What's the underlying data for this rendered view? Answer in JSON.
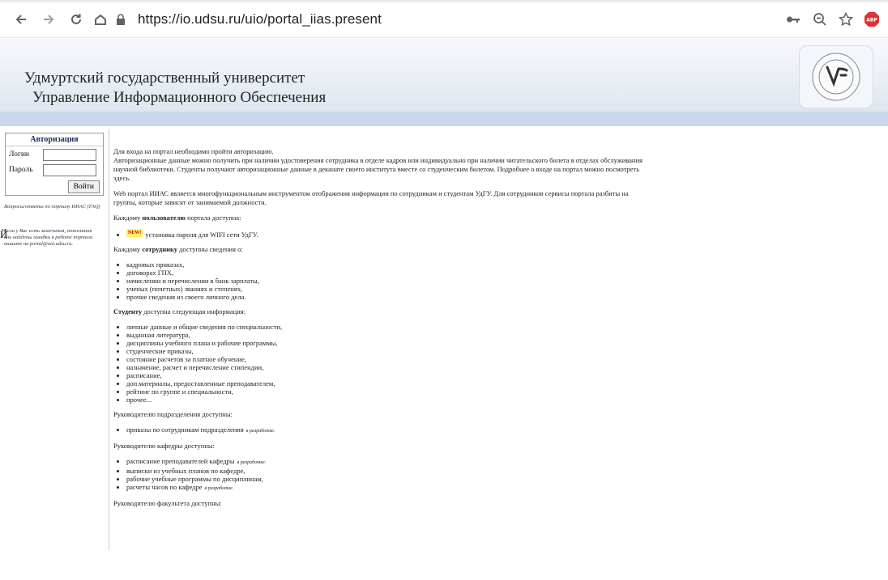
{
  "browser": {
    "url": "https://io.udsu.ru/uio/portal_iias.present"
  },
  "header": {
    "line1": "Удмуртский государственный университет",
    "line2": "Управление Информационного Обеспечения"
  },
  "sidebar": {
    "auth_title": "Авторизация",
    "login_label": "Логин",
    "password_label": "Пароль",
    "login_button": "Войти",
    "faq_note": "Вопросы/ответы по порталу ИИАС (FAQ)",
    "feedback_note": "Если у Вас есть замечания, пожелания или найдены ошибки в работе портала пишите на portal@uni.udsu.ru.",
    "stray_char": "Й"
  },
  "content": {
    "intro_p1": "Для входа на портал необходимо пройти авторизацию.",
    "intro_p2": "Авторизационные данные можно получить при наличии удостоверения сотрудника в отделе кадров или индивидуально при наличии читательского билета в отделах обслуживания научной библиотеки. Студенты получают авторизационные данные в деканате своего института вместе со студенческим билетом. Подробнее о входе на портал можно посмотреть здесь.",
    "web_p": "Web портал ИИАС является многофункциональным инструментом отображения информации по сотрудникам и студентам УдГУ. Для сотрудников сервисы портала разбиты на группы, которые зависят от занимаемой должности.",
    "users_heading_pre": "Каждому ",
    "users_heading_bold": "пользователю",
    "users_heading_post": " портала доступна:",
    "new_badge": "NEW!",
    "users_items": [
      "установка пароля для WIFI сети УдГУ."
    ],
    "staff_heading_pre": "Каждому ",
    "staff_heading_bold": "сотруднику",
    "staff_heading_post": " доступны сведения о:",
    "staff_items": [
      "кадровых приказах,",
      "договорах ГПХ,",
      "начислении и перечислении в банк зарплаты,",
      "ученых (почетных) званиях и степенях,",
      "прочие сведения из своего личного дела."
    ],
    "student_heading_bold": "Студенту",
    "student_heading_post": " доступна следующая информация:",
    "student_items": [
      "личные данные и общие сведения по специальности,",
      "выданная литература,",
      "дисциплины учебного плана и рабочие программы,",
      "студенческие приказы,",
      "состояние расчетов за платное обучение,",
      "назначение, расчет и перечисление стипендии,",
      "расписание,",
      "доп.материалы, предоставленные преподавателем,",
      "рейтинг по группе и специальности,",
      "прочее..."
    ],
    "dept_head_heading": "Руководителю подразделения доступны:",
    "dept_head_items": [
      "приказы по сотрудникам подразделения"
    ],
    "chair_heading": "Руководителю кафедры доступны:",
    "chair_items": [
      "расписание преподавателей кафедры",
      "выписки из учебных планов по кафедре,",
      "рабочие учебные программы по дисциплинам,",
      "расчеты часов по кафедре"
    ],
    "dev_tag": "в разработке.",
    "faculty_heading": "Руководителю факультета доступны:"
  }
}
